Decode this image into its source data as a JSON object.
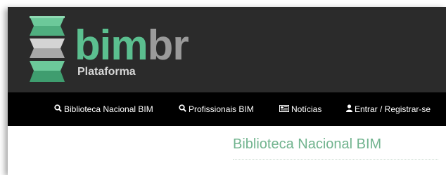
{
  "brand": {
    "name_primary": "bim",
    "name_secondary": "br",
    "subtitle": "Plataforma",
    "colors": {
      "green": "#5bbf8f",
      "gray": "#9a9a9a"
    }
  },
  "nav": {
    "items": [
      {
        "label": "Biblioteca Nacional BIM",
        "icon": "search-icon"
      },
      {
        "label": "Profissionais BIM",
        "icon": "search-icon"
      },
      {
        "label": "Notícias",
        "icon": "newspaper-icon"
      },
      {
        "label": "Entrar / Registrar-se",
        "icon": "user-icon"
      }
    ]
  },
  "main": {
    "title": "Biblioteca Nacional BIM"
  }
}
